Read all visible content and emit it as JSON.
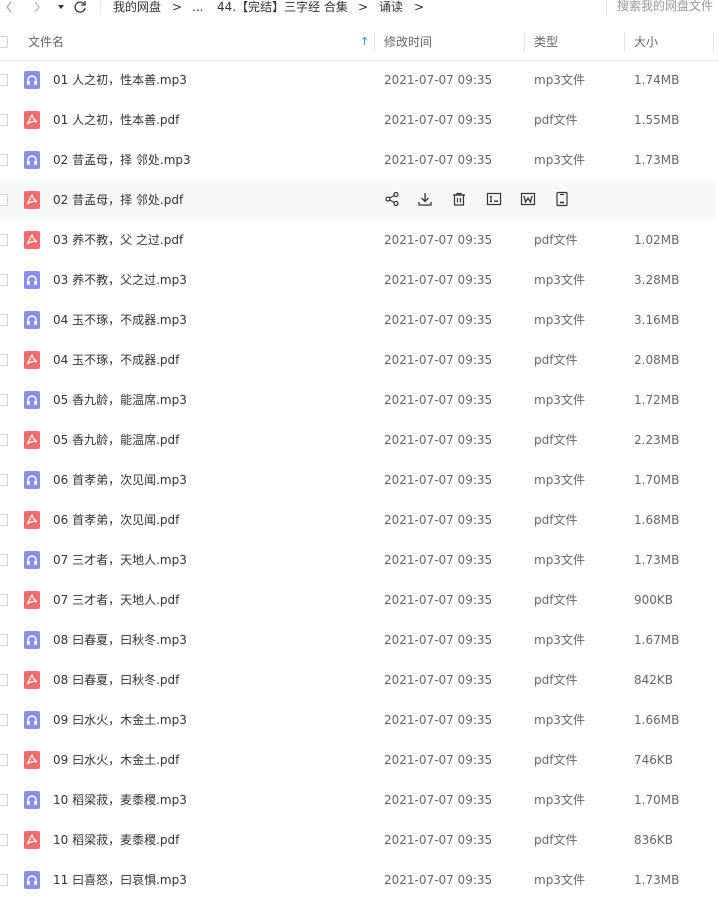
{
  "toolbar": {
    "back_icon": "chevron-left-icon",
    "forward_icon": "chevron-right-icon",
    "menu_icon": "caret-down-icon",
    "refresh_icon": "refresh-icon",
    "breadcrumbs": [
      "我的网盘",
      "...",
      "44.【完结】三字经 合集",
      "诵读"
    ],
    "separator": ">"
  },
  "search": {
    "placeholder": "搜索我的网盘文件"
  },
  "columns": {
    "name": "文件名",
    "modified": "修改时间",
    "type": "类型",
    "size": "大小"
  },
  "accent_color": "#2b8eff",
  "mp3_icon_color": "#8a8ef2",
  "pdf_icon_color": "#f36b6b",
  "files": [
    {
      "name": "01 人之初，性本善.mp3",
      "date": "2021-07-07 09:35",
      "type": "mp3文件",
      "size": "1.74MB",
      "kind": "mp3"
    },
    {
      "name": "01 人之初，性本善.pdf",
      "date": "2021-07-07 09:35",
      "type": "pdf文件",
      "size": "1.55MB",
      "kind": "pdf"
    },
    {
      "name": "02 昔孟母，择 邻处.mp3",
      "date": "2021-07-07 09:35",
      "type": "mp3文件",
      "size": "1.73MB",
      "kind": "mp3"
    },
    {
      "name": "02 昔孟母，择 邻处.pdf",
      "date": "",
      "type": "",
      "size": "",
      "kind": "pdf",
      "hover": true
    },
    {
      "name": "03 养不教，父 之过.pdf",
      "date": "2021-07-07 09:35",
      "type": "pdf文件",
      "size": "1.02MB",
      "kind": "pdf"
    },
    {
      "name": "03 养不教，父之过.mp3",
      "date": "2021-07-07 09:35",
      "type": "mp3文件",
      "size": "3.28MB",
      "kind": "mp3"
    },
    {
      "name": "04 玉不琢，不成器.mp3",
      "date": "2021-07-07 09:35",
      "type": "mp3文件",
      "size": "3.16MB",
      "kind": "mp3"
    },
    {
      "name": "04 玉不琢，不成器.pdf",
      "date": "2021-07-07 09:35",
      "type": "pdf文件",
      "size": "2.08MB",
      "kind": "pdf"
    },
    {
      "name": "05 香九龄，能温席.mp3",
      "date": "2021-07-07 09:35",
      "type": "mp3文件",
      "size": "1.72MB",
      "kind": "mp3"
    },
    {
      "name": "05 香九龄，能温席.pdf",
      "date": "2021-07-07 09:35",
      "type": "pdf文件",
      "size": "2.23MB",
      "kind": "pdf"
    },
    {
      "name": "06 首孝弟，次见闻.mp3",
      "date": "2021-07-07 09:35",
      "type": "mp3文件",
      "size": "1.70MB",
      "kind": "mp3"
    },
    {
      "name": "06 首孝弟，次见闻.pdf",
      "date": "2021-07-07 09:35",
      "type": "pdf文件",
      "size": "1.68MB",
      "kind": "pdf"
    },
    {
      "name": "07 三才者，天地人.mp3",
      "date": "2021-07-07 09:35",
      "type": "mp3文件",
      "size": "1.73MB",
      "kind": "mp3"
    },
    {
      "name": "07 三才者，天地人.pdf",
      "date": "2021-07-07 09:35",
      "type": "pdf文件",
      "size": "900KB",
      "kind": "pdf"
    },
    {
      "name": "08 曰春夏，曰秋冬.mp3",
      "date": "2021-07-07 09:35",
      "type": "mp3文件",
      "size": "1.67MB",
      "kind": "mp3"
    },
    {
      "name": "08 曰春夏，曰秋冬.pdf",
      "date": "2021-07-07 09:35",
      "type": "pdf文件",
      "size": "842KB",
      "kind": "pdf"
    },
    {
      "name": "09 曰水火，木金土.mp3",
      "date": "2021-07-07 09:35",
      "type": "mp3文件",
      "size": "1.66MB",
      "kind": "mp3"
    },
    {
      "name": "09 曰水火，木金土.pdf",
      "date": "2021-07-07 09:35",
      "type": "pdf文件",
      "size": "746KB",
      "kind": "pdf"
    },
    {
      "name": "10 稻梁菽，麦黍稷.mp3",
      "date": "2021-07-07 09:35",
      "type": "mp3文件",
      "size": "1.70MB",
      "kind": "mp3"
    },
    {
      "name": "10 稻梁菽，麦黍稷.pdf",
      "date": "2021-07-07 09:35",
      "type": "pdf文件",
      "size": "836KB",
      "kind": "pdf"
    },
    {
      "name": "11 曰喜怒，曰哀惧.mp3",
      "date": "2021-07-07 09:35",
      "type": "mp3文件",
      "size": "1.73MB",
      "kind": "mp3"
    }
  ],
  "row_actions": [
    "share-icon",
    "download-icon",
    "delete-icon",
    "rename-icon",
    "word-convert-icon",
    "more-icon"
  ]
}
